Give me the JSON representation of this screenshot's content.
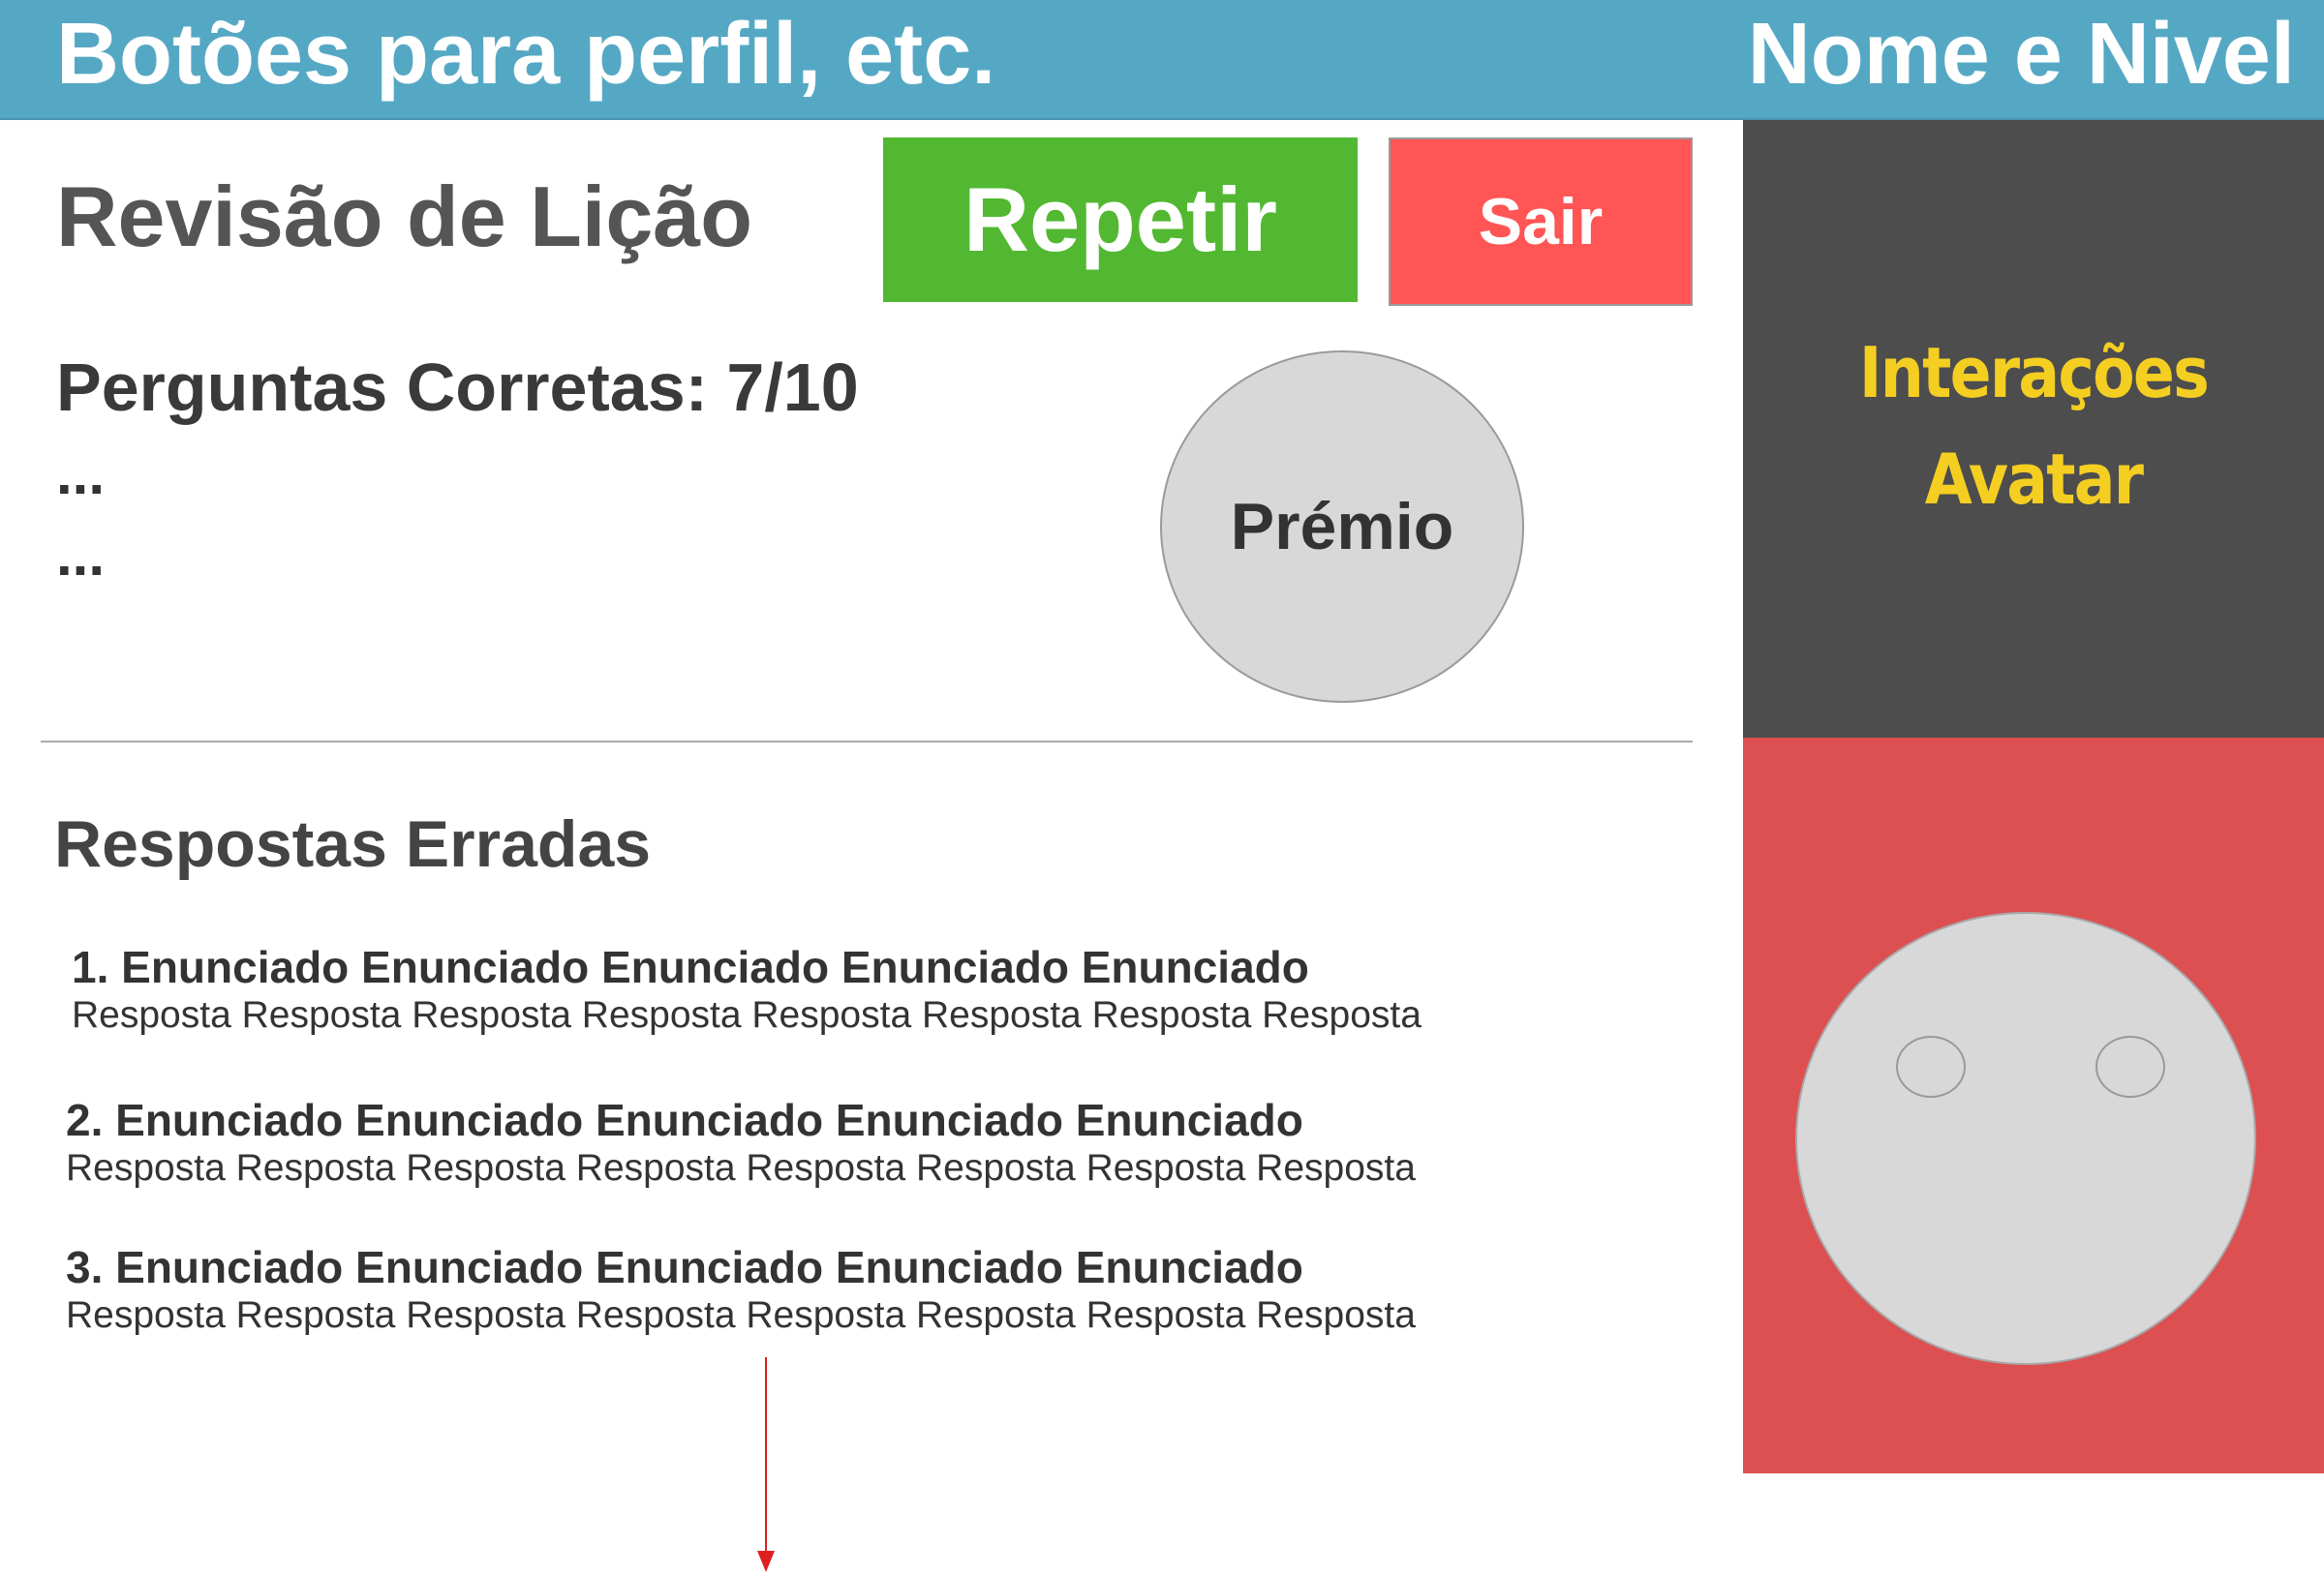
{
  "header": {
    "left_text": "Botões para perfil, etc.",
    "right_text": "Nome e Nivel"
  },
  "main": {
    "title": "Revisão de Lição",
    "repeat_label": "Repetir",
    "exit_label": "Sair",
    "score_text": "Perguntas Corretas: 7/10",
    "ellipsis_1": "...",
    "ellipsis_2": "...",
    "prize_label": "Prémio",
    "wrong_answers_title": "Respostas Erradas",
    "wrong_answers": [
      {
        "statement": "1. Enunciado Enunciado Enunciado Enunciado Enunciado",
        "answer": "Resposta Resposta Resposta Resposta Resposta Resposta Resposta Resposta"
      },
      {
        "statement": "2. Enunciado Enunciado Enunciado Enunciado Enunciado",
        "answer": "Resposta Resposta Resposta Resposta Resposta Resposta Resposta Resposta"
      },
      {
        "statement": "3. Enunciado Enunciado Enunciado Enunciado Enunciado",
        "answer": "Resposta Resposta Resposta Resposta Resposta Resposta Resposta Resposta"
      }
    ]
  },
  "sidebar": {
    "avatar_line_1": "Interações",
    "avatar_line_2": "Avatar"
  },
  "icons": {
    "scroll_indicator": "arrow-down-icon",
    "avatar_face": "face-icon"
  },
  "colors": {
    "header": "#55a8c4",
    "repeat_button": "#52b832",
    "exit_button": "#ff5555",
    "avatar_panel": "#4d4d4d",
    "avatar_text": "#f5ce22",
    "face_panel": "#dc5052",
    "face": "#d8d8d8",
    "arrow": "#e02020"
  }
}
